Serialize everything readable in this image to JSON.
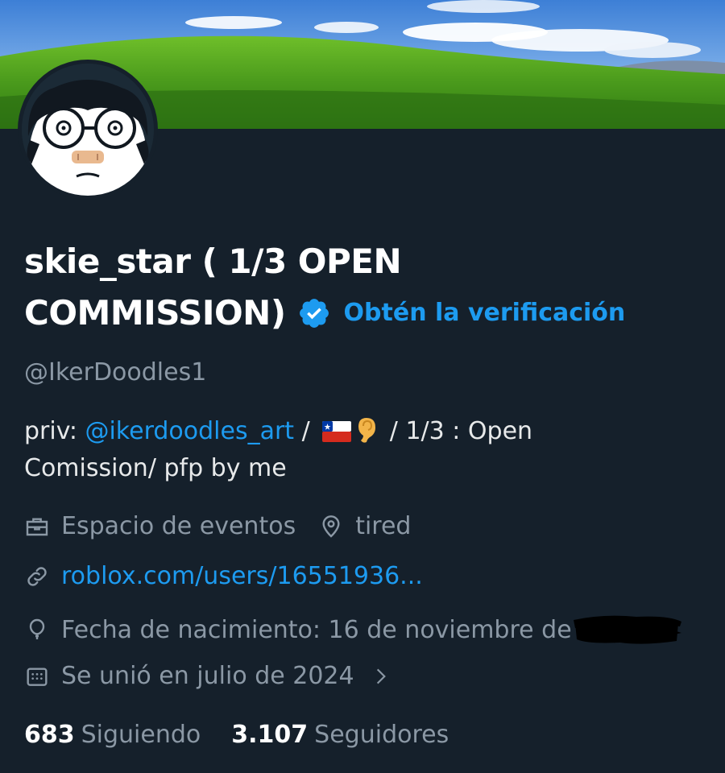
{
  "profile": {
    "display_name_line1": "skie_star ( 1/3 OPEN",
    "display_name_line2": "COMMISSION)",
    "verify_link": "Obtén la verificación",
    "handle": "@IkerDoodles1"
  },
  "bio": {
    "prefix": "priv: ",
    "mention": "@ikerdoodles_art",
    "sep1": " / ",
    "emoji_flag": "chile-flag-icon",
    "emoji_ear": "ear-icon",
    "after_emoji": " / 1/3 : Open",
    "line2": "Comission/ pfp by me"
  },
  "meta": {
    "category": "Espacio de eventos",
    "location": "tired",
    "website": "roblox.com/users/16551936...",
    "birthday": "Fecha de nacimiento: 16 de noviembre de",
    "joined": "Se unió en julio de 2024"
  },
  "stats": {
    "following_count": "683",
    "following_label": "Siguiendo",
    "followers_count": "3.107",
    "followers_label": "Seguidores"
  },
  "colors": {
    "background": "#15202b",
    "accent": "#1d9bf0",
    "muted": "#8b98a5"
  }
}
